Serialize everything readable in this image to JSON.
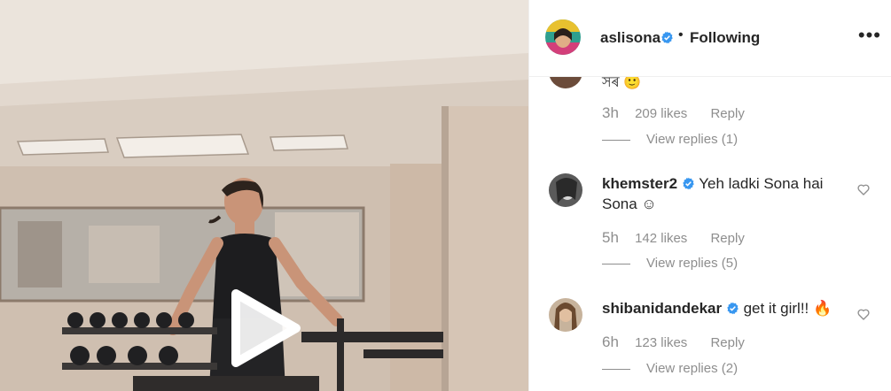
{
  "post": {
    "username": "aslisona",
    "separator": "•",
    "follow_label": "Following",
    "more_label": "•••"
  },
  "partial_comment": {
    "text_fragment": "সৰ 🙂",
    "time": "3h",
    "likes": "209 likes",
    "reply_label": "Reply",
    "view_replies": "View replies (1)"
  },
  "comments": [
    {
      "username": "khemster2",
      "text": "Yeh ladki Sona hai Sona ☺",
      "time": "5h",
      "likes": "142 likes",
      "reply_label": "Reply",
      "view_replies": "View replies (5)"
    },
    {
      "username": "shibanidandekar",
      "text": "get it girl!! 🔥",
      "time": "6h",
      "likes": "123 likes",
      "reply_label": "Reply",
      "view_replies": "View replies (2)"
    }
  ],
  "icons": {
    "verified": "verified-badge-icon",
    "like": "heart-outline-icon",
    "play": "play-icon",
    "more": "more-options-icon"
  },
  "colors": {
    "verified": "#3897f0",
    "muted_text": "#8e8e8e",
    "text": "#262626"
  }
}
